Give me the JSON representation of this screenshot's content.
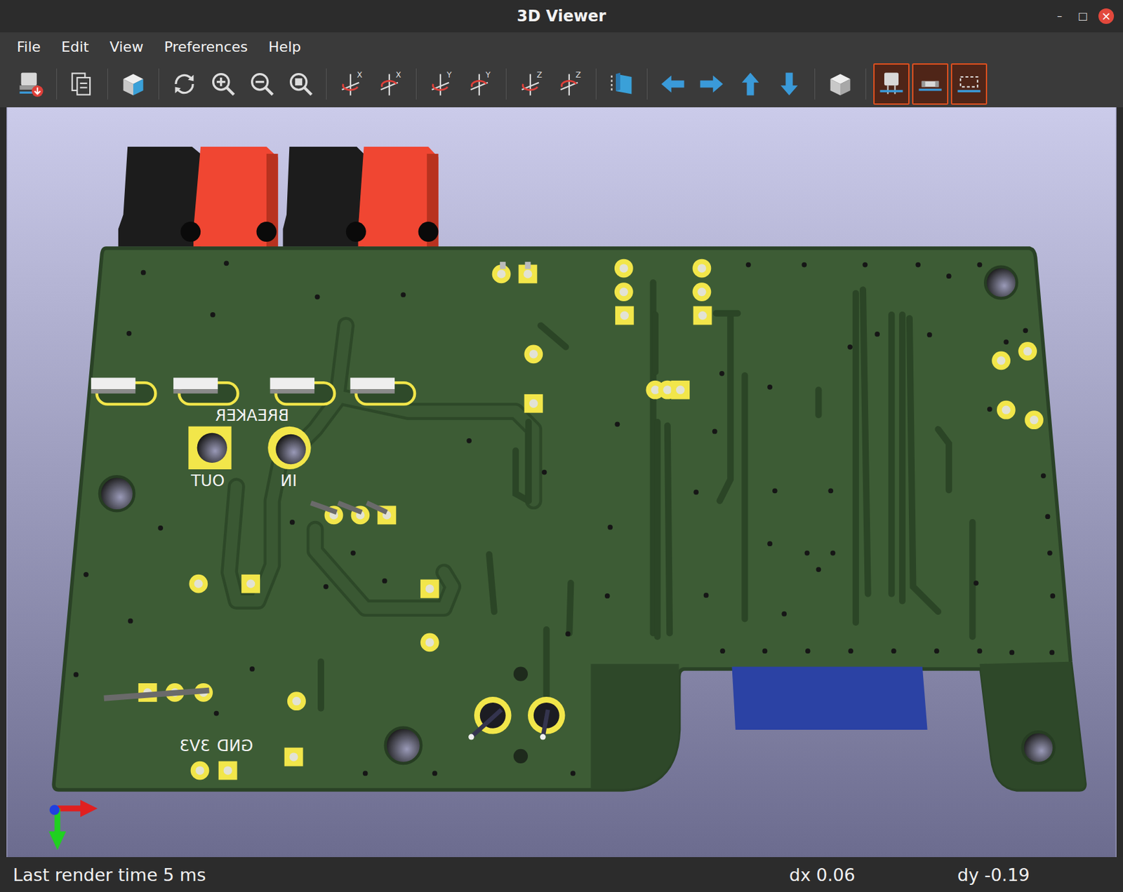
{
  "window": {
    "title": "3D Viewer",
    "controls": [
      "–",
      "□",
      "×"
    ]
  },
  "menu": [
    {
      "label": "File"
    },
    {
      "label": "Edit"
    },
    {
      "label": "View"
    },
    {
      "label": "Preferences"
    },
    {
      "label": "Help"
    }
  ],
  "toolbar": [
    [
      {
        "kind": "export",
        "selected": false
      }
    ],
    [
      {
        "kind": "copy",
        "selected": false
      }
    ],
    [
      {
        "kind": "view3d",
        "selected": false
      }
    ],
    [
      {
        "kind": "reload",
        "selected": false
      },
      {
        "kind": "zoomin",
        "selected": false
      },
      {
        "kind": "zoomout",
        "selected": false
      },
      {
        "kind": "zoomfit",
        "selected": false
      }
    ],
    [
      {
        "kind": "rotcw",
        "label": "X",
        "selected": false
      },
      {
        "kind": "rotccw",
        "label": "X",
        "selected": false
      }
    ],
    [
      {
        "kind": "rotcw",
        "label": "Y",
        "selected": false
      },
      {
        "kind": "rotccw",
        "label": "Y",
        "selected": false
      }
    ],
    [
      {
        "kind": "rotcw",
        "label": "Z",
        "selected": false
      },
      {
        "kind": "rotccw",
        "label": "Z",
        "selected": false
      }
    ],
    [
      {
        "kind": "flip",
        "selected": false
      }
    ],
    [
      {
        "kind": "left",
        "selected": false
      },
      {
        "kind": "right",
        "selected": false
      },
      {
        "kind": "up",
        "selected": false
      },
      {
        "kind": "down",
        "selected": false
      }
    ],
    [
      {
        "kind": "ortho",
        "selected": false
      }
    ],
    [
      {
        "kind": "tht",
        "selected": true
      },
      {
        "kind": "smd",
        "selected": true
      },
      {
        "kind": "virtual",
        "selected": true
      }
    ]
  ],
  "board": {
    "labels": [
      "BREAKER",
      "OUT",
      "IN",
      "3V3",
      "GND"
    ]
  },
  "status_bar": {
    "message": "Last render time 5 ms",
    "dx": "dx 0.06",
    "dy": "dy -0.19"
  }
}
